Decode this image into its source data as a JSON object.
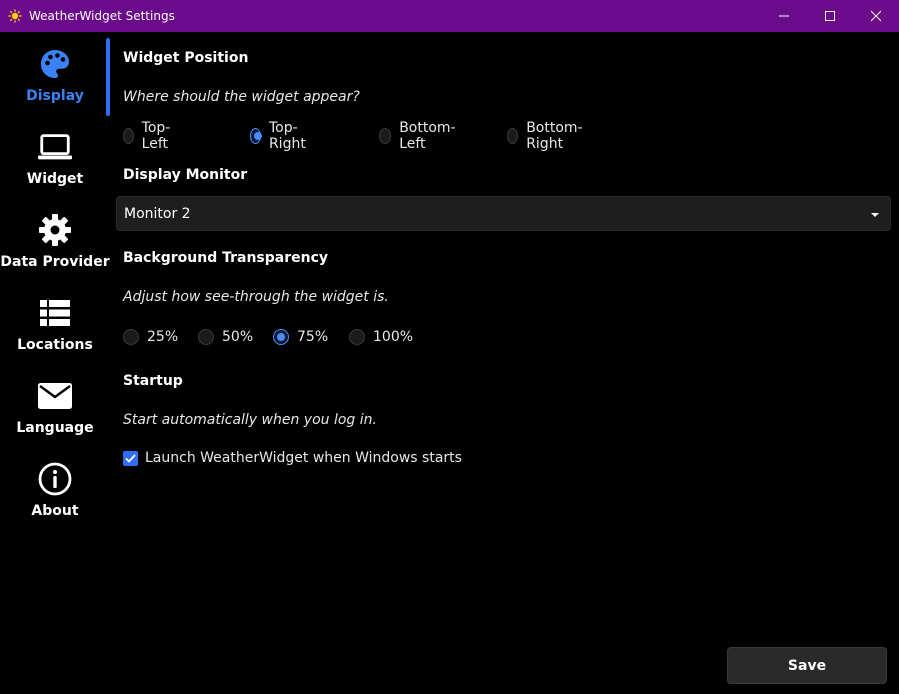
{
  "window": {
    "title": "WeatherWidget Settings",
    "app_icon": "sun-icon"
  },
  "sidebar": {
    "items": [
      {
        "label": "Display",
        "icon": "palette-icon",
        "active": true
      },
      {
        "label": "Widget",
        "icon": "laptop-icon",
        "active": false
      },
      {
        "label": "Data Provider",
        "icon": "gear-icon",
        "active": false
      },
      {
        "label": "Locations",
        "icon": "list-icon",
        "active": false
      },
      {
        "label": "Language",
        "icon": "envelope-icon",
        "active": false
      },
      {
        "label": "About",
        "icon": "info-icon",
        "active": false
      }
    ]
  },
  "position": {
    "title": "Widget Position",
    "description": "Where should the widget appear?",
    "options": [
      "Top-Left",
      "Top-Right",
      "Bottom-Left",
      "Bottom-Right"
    ],
    "selected": "Top-Right"
  },
  "monitor": {
    "title": "Display Monitor",
    "value": "Monitor 2"
  },
  "transparency": {
    "title": "Background Transparency",
    "description": "Adjust how see-through the widget is.",
    "options": [
      "25%",
      "50%",
      "75%",
      "100%"
    ],
    "selected": "75%"
  },
  "startup": {
    "title": "Startup",
    "description": "Start automatically when you log in.",
    "checkbox_label": "Launch WeatherWidget when Windows starts",
    "checked": true
  },
  "actions": {
    "save_label": "Save"
  },
  "colors": {
    "titlebar": "#6b0a8a",
    "accent": "#2f6df2",
    "background": "#000000"
  }
}
